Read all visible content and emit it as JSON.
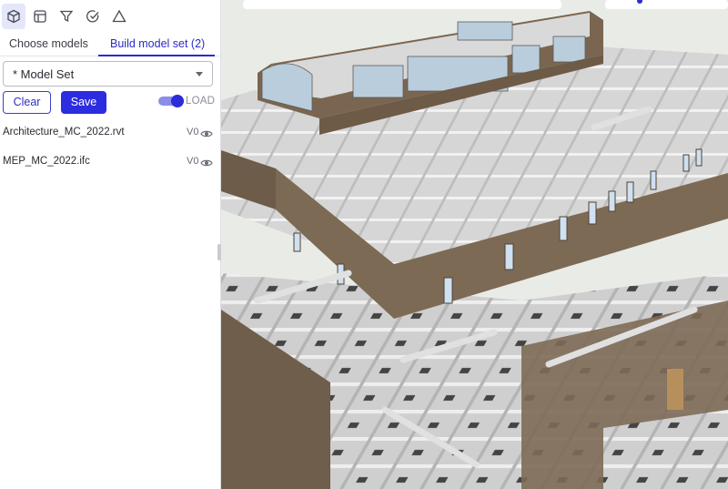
{
  "toolbar": {
    "icons": [
      "cube-icon",
      "layout-icon",
      "filter-icon",
      "check-circle-icon",
      "warning-triangle-icon"
    ]
  },
  "tabs": [
    {
      "label": "Choose models"
    },
    {
      "label": "Build model set (2)"
    }
  ],
  "model_set_select": {
    "value": "* Model Set"
  },
  "actions": {
    "clear_label": "Clear",
    "save_label": "Save"
  },
  "load_toggle": {
    "label": "LOAD",
    "on": true
  },
  "models": [
    {
      "name": "Architecture_MC_2022.rvt",
      "version": "V0"
    },
    {
      "name": "MEP_MC_2022.ifc",
      "version": "V0"
    }
  ],
  "colors": {
    "accent": "#2c2ce0",
    "wall_brown": "#7d6a55",
    "viewport_bg": "#e9ece6"
  }
}
